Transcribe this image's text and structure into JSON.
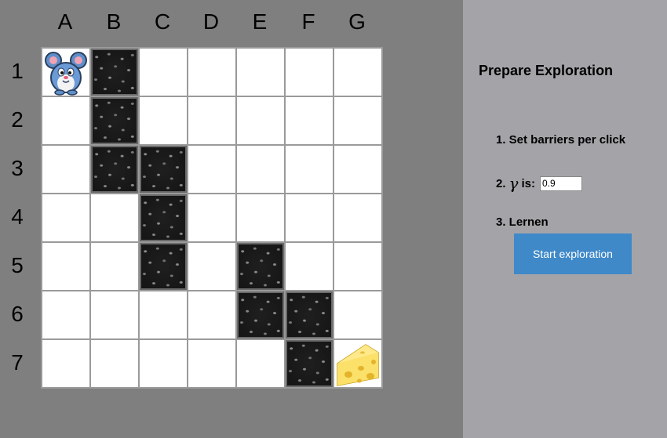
{
  "grid": {
    "columns": [
      "A",
      "B",
      "C",
      "D",
      "E",
      "F",
      "G"
    ],
    "rows": [
      "1",
      "2",
      "3",
      "4",
      "5",
      "6",
      "7"
    ],
    "mouse_cell": "A1",
    "cheese_cell": "G7",
    "barriers": [
      "B1",
      "B2",
      "B3",
      "C3",
      "C4",
      "C5",
      "E5",
      "E6",
      "F6",
      "F7"
    ]
  },
  "panel": {
    "title": "Prepare Exploration",
    "step1_label": "1. Set barriers per click",
    "step2_prefix": "2.",
    "step2_symbol": "γ",
    "step2_suffix": "is:",
    "gamma_value": "0.9",
    "step3_label": "3. Lernen",
    "start_button": "Start exploration"
  },
  "colors": {
    "left_background": "#7f7f7f",
    "right_background": "#a4a4a8",
    "button": "#3f89c9"
  },
  "icons": {
    "mouse": "mouse-icon",
    "cheese": "cheese-icon",
    "barrier": "rock-barrier-icon"
  }
}
